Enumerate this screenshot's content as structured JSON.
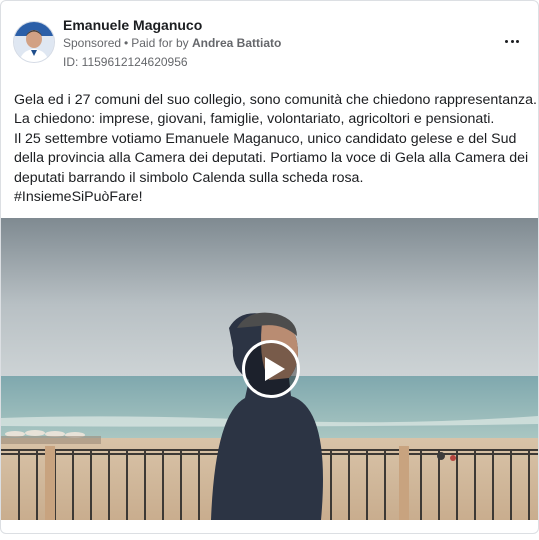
{
  "ad": {
    "page_name": "Emanuele Maganuco",
    "sponsored_label": "Sponsored",
    "paid_for_prefix": "Paid for by",
    "payer": "Andrea Battiato",
    "library_id": "ID: 1159612124620956",
    "body_lines": [
      "Gela ed i 27 comuni del suo collegio, sono comunità che chiedono rappresentanza.",
      "La chiedono: imprese, giovani, famiglie, volontariato, agricoltori e pensionati.",
      "Il 25 settembre votiamo Emanuele Maganuco, unico candidato gelese e del Sud",
      "della provincia alla Camera dei deputati. Portiamo la voce di Gela alla Camera dei",
      "deputati barrando il simbolo Calenda sulla scheda rosa.",
      "#InsiemeSiPuòFare!"
    ]
  },
  "icons": {
    "more": "more-options-icon",
    "play": "play-icon",
    "avatar": "profile-avatar"
  },
  "colors": {
    "text": "#1c1e21",
    "secondary_text": "#65676b",
    "border": "#dcdfe3"
  }
}
